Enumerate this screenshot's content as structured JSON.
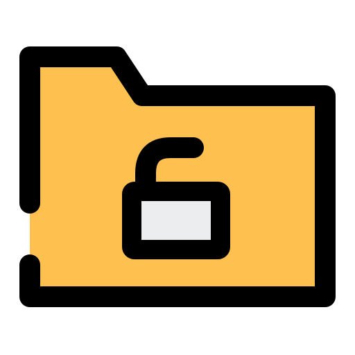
{
  "icon": {
    "name": "unlocked-folder-icon",
    "parts": [
      "folder-icon",
      "open-padlock-icon"
    ]
  },
  "colors": {
    "folder_fill": "#FEC04F",
    "outline": "#000000",
    "lock_body_fill": "#EBEDEF",
    "background": "#FFFFFF"
  }
}
